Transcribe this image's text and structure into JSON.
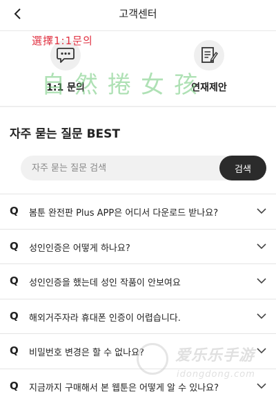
{
  "header": {
    "title": "고객센터"
  },
  "actions": [
    {
      "label": "1:1 문의",
      "icon": "chat-bubble-icon"
    },
    {
      "label": "연재제안",
      "icon": "document-pen-icon"
    }
  ],
  "overlays": {
    "red_text": "選擇1:1문의",
    "green_text": "自然捲女孩"
  },
  "faq": {
    "title": "자주 묻는 질문 BEST",
    "search_placeholder": "자주 묻는 질문 검색",
    "search_button": "검색",
    "q_marker": "Q",
    "items": [
      {
        "text": "봄툰 완전판 Plus APP은 어디서 다운로드 받나요?"
      },
      {
        "text": "성인인증은 어떻게 하나요?"
      },
      {
        "text": "성인인증을 했는데 성인 작품이 안보여요"
      },
      {
        "text": "해외거주자라 휴대폰 인증이 어렵습니다."
      },
      {
        "text": "비밀번호 변경은 할 수 없나요?"
      },
      {
        "text": "지금까지 구매해서 본 웹툰은 어떻게 알 수 있나요?"
      }
    ]
  },
  "watermark": {
    "main": "爱乐乐手游",
    "sub": "idongdong.com"
  },
  "colors": {
    "accent_dark": "#2b2b2b",
    "overlay_red": "#e03040",
    "overlay_green": "#6ec878"
  }
}
